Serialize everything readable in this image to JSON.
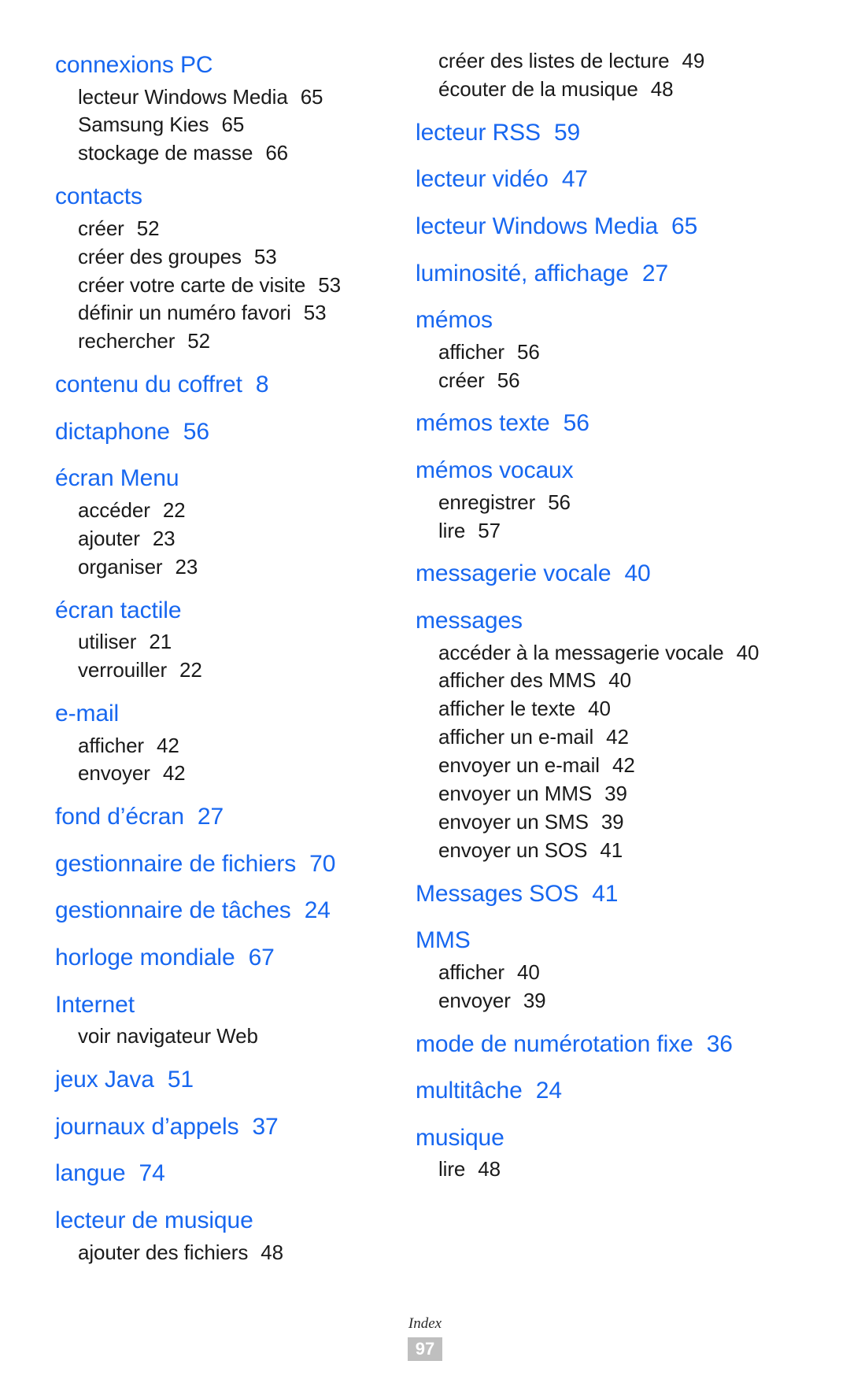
{
  "document": {
    "footer_label": "Index",
    "page_number": "97",
    "heading_color": "#1767f0",
    "body_color": "#1a1a1a",
    "badge_color": "#bfbfbf"
  },
  "left_column": [
    {
      "head": "connexions PC",
      "head_page": "",
      "subs": [
        {
          "label": "lecteur Windows Media",
          "page": "65"
        },
        {
          "label": "Samsung Kies",
          "page": "65"
        },
        {
          "label": "stockage de masse",
          "page": "66"
        }
      ]
    },
    {
      "head": "contacts",
      "head_page": "",
      "subs": [
        {
          "label": "créer",
          "page": "52"
        },
        {
          "label": "créer des groupes",
          "page": "53"
        },
        {
          "label": "créer votre carte de visite",
          "page": "53"
        },
        {
          "label": "définir un numéro favori",
          "page": "53"
        },
        {
          "label": "rechercher",
          "page": "52"
        }
      ]
    },
    {
      "head": "contenu du coffret",
      "head_page": "8",
      "subs": []
    },
    {
      "head": "dictaphone",
      "head_page": "56",
      "subs": []
    },
    {
      "head": "écran Menu",
      "head_page": "",
      "subs": [
        {
          "label": "accéder",
          "page": "22"
        },
        {
          "label": "ajouter",
          "page": "23"
        },
        {
          "label": "organiser",
          "page": "23"
        }
      ]
    },
    {
      "head": "écran tactile",
      "head_page": "",
      "subs": [
        {
          "label": "utiliser",
          "page": "21"
        },
        {
          "label": "verrouiller",
          "page": "22"
        }
      ]
    },
    {
      "head": "e-mail",
      "head_page": "",
      "subs": [
        {
          "label": "afficher",
          "page": "42"
        },
        {
          "label": "envoyer",
          "page": "42"
        }
      ]
    },
    {
      "head": "fond d’écran",
      "head_page": "27",
      "subs": []
    },
    {
      "head": "gestionnaire de fichiers",
      "head_page": "70",
      "subs": []
    },
    {
      "head": "gestionnaire de tâches",
      "head_page": "24",
      "subs": []
    },
    {
      "head": "horloge mondiale",
      "head_page": "67",
      "subs": []
    },
    {
      "head": "Internet",
      "head_page": "",
      "subs": [
        {
          "label": "voir navigateur Web",
          "page": ""
        }
      ]
    },
    {
      "head": "jeux Java",
      "head_page": "51",
      "subs": []
    },
    {
      "head": "journaux d’appels",
      "head_page": "37",
      "subs": []
    },
    {
      "head": "langue",
      "head_page": "74",
      "subs": []
    },
    {
      "head": "lecteur de musique",
      "head_page": "",
      "subs": [
        {
          "label": "ajouter des fichiers",
          "page": "48"
        }
      ]
    }
  ],
  "right_column": [
    {
      "head": "",
      "head_page": "",
      "subs": [
        {
          "label": "créer des listes de lecture",
          "page": "49"
        },
        {
          "label": "écouter de la musique",
          "page": "48"
        }
      ]
    },
    {
      "head": "lecteur RSS",
      "head_page": "59",
      "subs": []
    },
    {
      "head": "lecteur vidéo",
      "head_page": "47",
      "subs": []
    },
    {
      "head": "lecteur Windows Media",
      "head_page": "65",
      "subs": []
    },
    {
      "head": "luminosité, affichage",
      "head_page": "27",
      "subs": []
    },
    {
      "head": "mémos",
      "head_page": "",
      "subs": [
        {
          "label": "afficher",
          "page": "56"
        },
        {
          "label": "créer",
          "page": "56"
        }
      ]
    },
    {
      "head": "mémos texte",
      "head_page": "56",
      "subs": []
    },
    {
      "head": "mémos vocaux",
      "head_page": "",
      "subs": [
        {
          "label": "enregistrer",
          "page": "56"
        },
        {
          "label": "lire",
          "page": "57"
        }
      ]
    },
    {
      "head": "messagerie vocale",
      "head_page": "40",
      "subs": []
    },
    {
      "head": "messages",
      "head_page": "",
      "subs": [
        {
          "label": "accéder à la messagerie vocale",
          "page": "40"
        },
        {
          "label": "afficher des MMS",
          "page": "40"
        },
        {
          "label": "afficher le texte",
          "page": "40"
        },
        {
          "label": "afficher un e-mail",
          "page": "42"
        },
        {
          "label": "envoyer un e-mail",
          "page": "42"
        },
        {
          "label": "envoyer un MMS",
          "page": "39"
        },
        {
          "label": "envoyer un SMS",
          "page": "39"
        },
        {
          "label": "envoyer un SOS",
          "page": "41"
        }
      ]
    },
    {
      "head": "Messages SOS",
      "head_page": "41",
      "subs": []
    },
    {
      "head": "MMS",
      "head_page": "",
      "subs": [
        {
          "label": "afficher",
          "page": "40"
        },
        {
          "label": "envoyer",
          "page": "39"
        }
      ]
    },
    {
      "head": "mode de numérotation fixe",
      "head_page": "36",
      "subs": []
    },
    {
      "head": "multitâche",
      "head_page": "24",
      "subs": []
    },
    {
      "head": "musique",
      "head_page": "",
      "subs": [
        {
          "label": "lire",
          "page": "48"
        }
      ]
    }
  ]
}
